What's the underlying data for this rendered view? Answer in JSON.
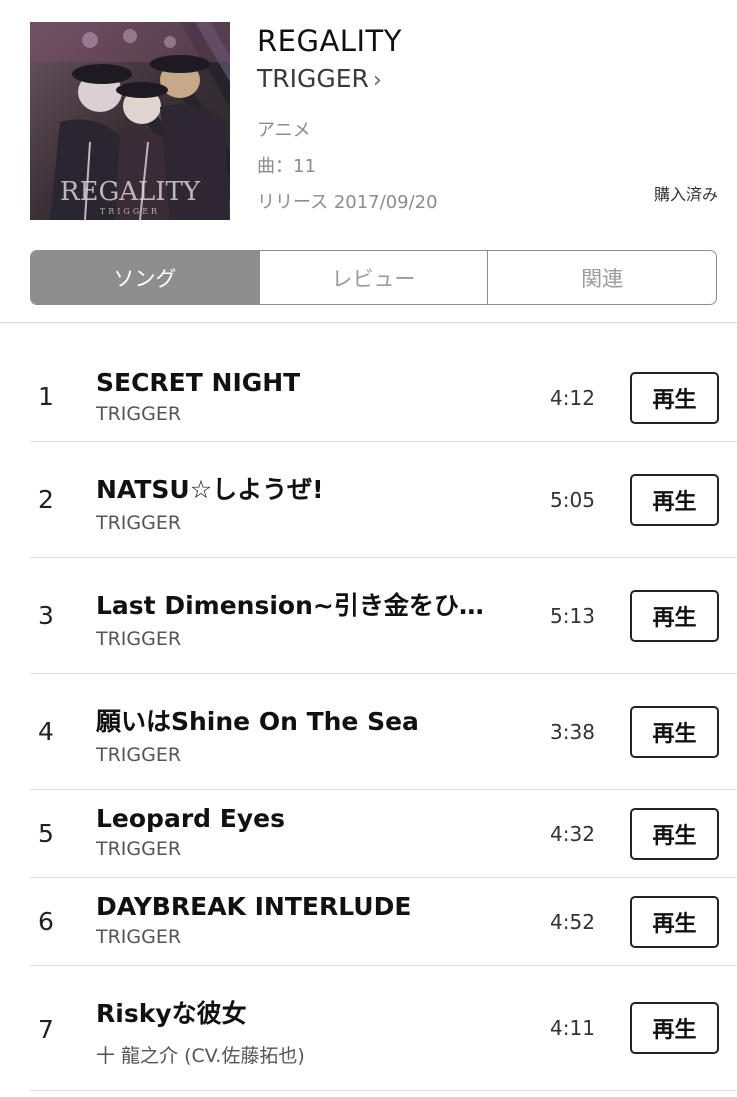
{
  "album": {
    "title": "REGALITY",
    "artist": "TRIGGER",
    "genre": "アニメ",
    "track_count": "曲：11",
    "release": "リリース 2017/09/20",
    "purchase_status": "購入済み",
    "cover_text": "REGALITY",
    "cover_subtext": "TRIGGER"
  },
  "tabs": [
    {
      "label": "ソング",
      "active": true
    },
    {
      "label": "レビュー",
      "active": false
    },
    {
      "label": "関連",
      "active": false
    }
  ],
  "tracks": [
    {
      "number": "1",
      "title": "SECRET NIGHT",
      "artist": "TRIGGER",
      "duration": "4:12",
      "play_label": "再生"
    },
    {
      "number": "2",
      "title": "NATSU☆しようぜ!",
      "artist": "TRIGGER",
      "duration": "5:05",
      "play_label": "再生"
    },
    {
      "number": "3",
      "title": "Last Dimension~引き金をひ…",
      "artist": "TRIGGER",
      "duration": "5:13",
      "play_label": "再生"
    },
    {
      "number": "4",
      "title": "願いはShine On The Sea",
      "artist": "TRIGGER",
      "duration": "3:38",
      "play_label": "再生"
    },
    {
      "number": "5",
      "title": "Leopard Eyes",
      "artist": "TRIGGER",
      "duration": "4:32",
      "play_label": "再生"
    },
    {
      "number": "6",
      "title": "DAYBREAK INTERLUDE",
      "artist": "TRIGGER",
      "duration": "4:52",
      "play_label": "再生"
    },
    {
      "number": "7",
      "title": "Riskyな彼女",
      "artist": "十 龍之介 (CV.佐藤拓也)",
      "duration": "4:11",
      "play_label": "再生"
    }
  ],
  "icons": {
    "artist_chevron": "chevron-right-icon"
  }
}
